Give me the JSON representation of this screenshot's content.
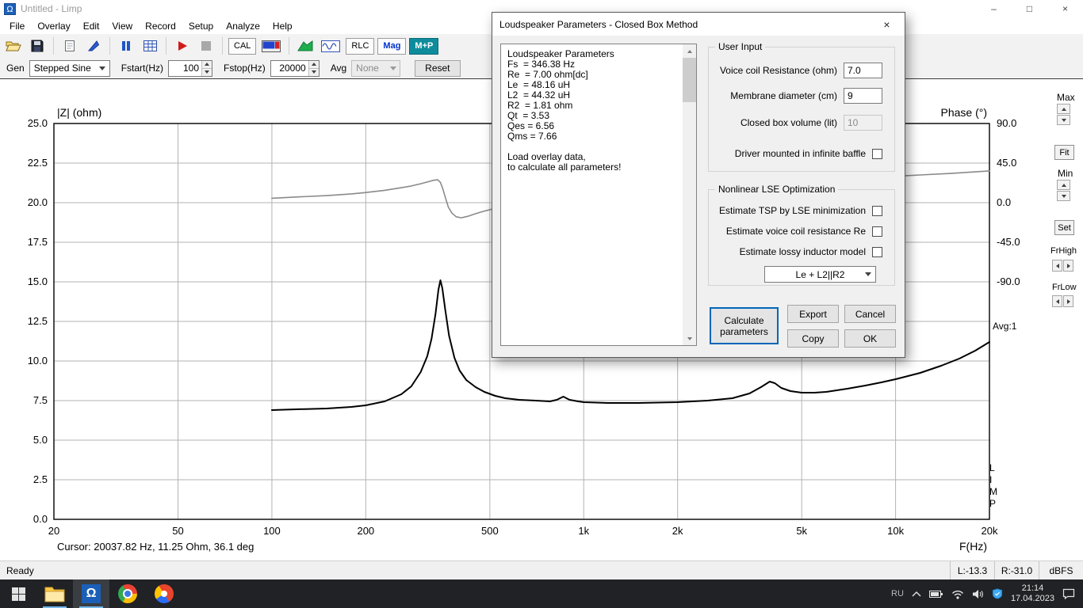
{
  "window": {
    "title": "Untitled - Limp",
    "icon_glyph": "Ω",
    "controls": {
      "minimize": "–",
      "maximize": "□",
      "close": "×"
    },
    "menu": [
      "File",
      "Overlay",
      "Edit",
      "View",
      "Record",
      "Setup",
      "Analyze",
      "Help"
    ]
  },
  "toolbar": {
    "cal_label": "CAL",
    "rlc_label": "RLC",
    "mag_label": "Mag",
    "mp_label": "M+P"
  },
  "genbar": {
    "gen_label": "Gen",
    "gen_value": "Stepped Sine",
    "fstart_label": "Fstart(Hz)",
    "fstart_value": "100",
    "fstop_label": "Fstop(Hz)",
    "fstop_value": "20000",
    "avg_label": "Avg",
    "avg_value": "None",
    "reset_label": "Reset"
  },
  "chart_data": {
    "type": "line",
    "x_axis": {
      "label": "F(Hz)",
      "scale": "log",
      "min": 20,
      "max": 20000,
      "tick_values": [
        20,
        50,
        100,
        200,
        500,
        1000,
        2000,
        5000,
        10000,
        20000
      ],
      "tick_labels": [
        "20",
        "50",
        "100",
        "200",
        "500",
        "1k",
        "2k",
        "5k",
        "10k",
        "20k"
      ]
    },
    "y_left": {
      "label": "|Z| (ohm)",
      "min": 0,
      "max": 25,
      "step": 2.5,
      "tick_labels": [
        "25.0",
        "22.5",
        "20.0",
        "17.5",
        "15.0",
        "12.5",
        "10.0",
        "7.5",
        "5.0",
        "2.5",
        "0.0"
      ]
    },
    "y_right": {
      "label": "Phase (°)",
      "tick_labels": [
        "90.0",
        "45.0",
        "0.0",
        "-45.0",
        "-90.0"
      ],
      "degrees_per_division": 45,
      "zero_at_left_value": 20
    },
    "grid": true,
    "cursor_readout": "Cursor: 20037.82 Hz, 11.25 Ohm, 36.1 deg",
    "series": [
      {
        "name": "phase",
        "axis": "right",
        "color": "#8a8a8a",
        "width": 1.6,
        "points": [
          [
            100,
            5
          ],
          [
            120,
            6.5
          ],
          [
            150,
            8
          ],
          [
            180,
            10
          ],
          [
            200,
            11.5
          ],
          [
            230,
            14
          ],
          [
            260,
            17
          ],
          [
            280,
            19
          ],
          [
            300,
            21.5
          ],
          [
            315,
            23.5
          ],
          [
            330,
            25.5
          ],
          [
            340,
            26
          ],
          [
            347,
            23
          ],
          [
            353,
            16
          ],
          [
            360,
            6
          ],
          [
            368,
            -5
          ],
          [
            378,
            -12
          ],
          [
            390,
            -16
          ],
          [
            405,
            -17.2
          ],
          [
            425,
            -15.5
          ],
          [
            450,
            -12.5
          ],
          [
            480,
            -9.5
          ],
          [
            520,
            -6.5
          ],
          [
            560,
            -4.5
          ],
          [
            620,
            -2
          ],
          [
            700,
            0.5
          ],
          [
            800,
            2.8
          ],
          [
            900,
            4.5
          ],
          [
            1000,
            6
          ],
          [
            1300,
            8.8
          ],
          [
            1600,
            11
          ],
          [
            2000,
            13
          ],
          [
            2600,
            15.5
          ],
          [
            3200,
            18
          ],
          [
            3800,
            20.5
          ],
          [
            4200,
            22
          ],
          [
            5000,
            24
          ],
          [
            6000,
            25.8
          ],
          [
            7000,
            27
          ],
          [
            8000,
            28.2
          ],
          [
            10000,
            30
          ],
          [
            12000,
            31.5
          ],
          [
            15000,
            33.2
          ],
          [
            18000,
            35
          ],
          [
            20000,
            36.1
          ]
        ]
      },
      {
        "name": "impedance",
        "axis": "left",
        "color": "#000000",
        "width": 2,
        "points": [
          [
            100,
            6.9
          ],
          [
            120,
            6.95
          ],
          [
            150,
            7.0
          ],
          [
            180,
            7.1
          ],
          [
            200,
            7.2
          ],
          [
            230,
            7.45
          ],
          [
            260,
            7.9
          ],
          [
            280,
            8.4
          ],
          [
            300,
            9.3
          ],
          [
            315,
            10.3
          ],
          [
            325,
            11.4
          ],
          [
            335,
            13.0
          ],
          [
            342,
            14.5
          ],
          [
            347,
            15.1
          ],
          [
            352,
            14.6
          ],
          [
            360,
            13.2
          ],
          [
            370,
            11.6
          ],
          [
            385,
            10.2
          ],
          [
            400,
            9.4
          ],
          [
            420,
            8.8
          ],
          [
            450,
            8.35
          ],
          [
            480,
            8.05
          ],
          [
            520,
            7.8
          ],
          [
            560,
            7.65
          ],
          [
            620,
            7.55
          ],
          [
            700,
            7.5
          ],
          [
            780,
            7.45
          ],
          [
            820,
            7.55
          ],
          [
            860,
            7.75
          ],
          [
            900,
            7.55
          ],
          [
            960,
            7.45
          ],
          [
            1000,
            7.4
          ],
          [
            1200,
            7.35
          ],
          [
            1500,
            7.35
          ],
          [
            2000,
            7.4
          ],
          [
            2500,
            7.5
          ],
          [
            3000,
            7.65
          ],
          [
            3400,
            7.95
          ],
          [
            3700,
            8.35
          ],
          [
            3950,
            8.7
          ],
          [
            4100,
            8.6
          ],
          [
            4300,
            8.3
          ],
          [
            4600,
            8.1
          ],
          [
            5000,
            8.0
          ],
          [
            5500,
            8.0
          ],
          [
            6000,
            8.05
          ],
          [
            7000,
            8.25
          ],
          [
            8000,
            8.45
          ],
          [
            9000,
            8.65
          ],
          [
            10000,
            8.85
          ],
          [
            12000,
            9.25
          ],
          [
            14000,
            9.7
          ],
          [
            16000,
            10.15
          ],
          [
            18000,
            10.65
          ],
          [
            20000,
            11.2
          ]
        ]
      }
    ]
  },
  "side_panel": {
    "max": "Max",
    "fit": "Fit",
    "min": "Min",
    "set": "Set",
    "fr_high": "FrHigh",
    "fr_low": "FrLow",
    "avg": "Avg:1",
    "logo_letters": "L\nI\nM\nP"
  },
  "dialog": {
    "title": "Loudspeaker Parameters - Closed Box Method",
    "close_glyph": "×",
    "results": [
      "Loudspeaker Parameters",
      "Fs  = 346.38 Hz",
      "Re  = 7.00 ohm[dc]",
      "Le  = 48.16 uH",
      "L2  = 44.32 uH",
      "R2  = 1.81 ohm",
      "Qt  = 3.53",
      "Qes = 6.56",
      "Qms = 7.66",
      "",
      "Load overlay data,",
      "to calculate all parameters!"
    ],
    "user_input": {
      "title": "User Input",
      "rows": [
        {
          "label": "Voice coil Resistance (ohm)",
          "value": "7.0"
        },
        {
          "label": "Membrane diameter (cm)",
          "value": "9"
        },
        {
          "label": "Closed box volume (lit)",
          "value": "10"
        }
      ],
      "baffle_label": "Driver mounted in infinite baffle"
    },
    "lse": {
      "title": "Nonlinear LSE Optimization",
      "checks": [
        "Estimate TSP by LSE minimization",
        "Estimate voice coil resistance Re",
        "Estimate lossy inductor model"
      ],
      "model_value": "Le + L2||R2"
    },
    "buttons": {
      "calculate": "Calculate parameters",
      "export": "Export",
      "cancel": "Cancel",
      "copy": "Copy",
      "ok": "OK"
    }
  },
  "status_bar": {
    "ready": "Ready",
    "left_level": "L:-13.3",
    "right_level": "R:-31.0",
    "units": "dBFS"
  },
  "taskbar": {
    "language": "RU",
    "time": "21:14",
    "date": "17.04.2023"
  }
}
